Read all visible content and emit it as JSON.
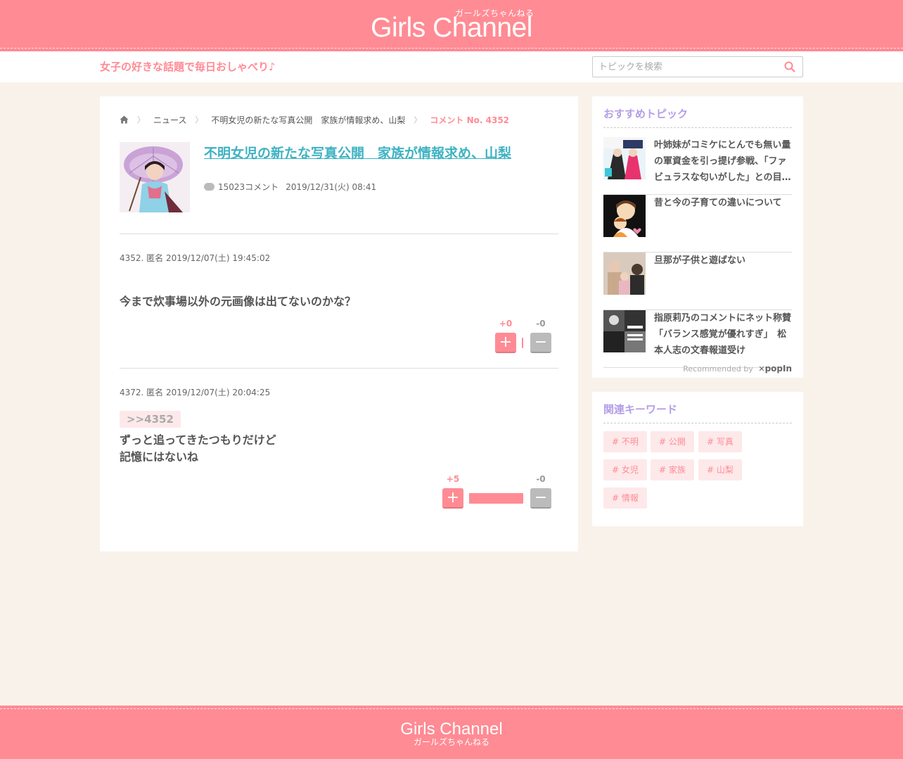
{
  "header": {
    "logo_kana": "ガールズちゃんねる",
    "logo_name": "Girls Channel",
    "tagline": "女子の好きな話題で毎日おしゃべり♪",
    "search_placeholder": "トピックを検索"
  },
  "breadcrumb": {
    "news": "ニュース",
    "topic": "不明女児の新たな写真公開　家族が情報求め、山梨",
    "current": "コメント No. 4352"
  },
  "topic": {
    "title": "不明女児の新たな写真公開　家族が情報求め、山梨",
    "comment_count": "15023コメント",
    "date": "2019/12/31(火) 08:41"
  },
  "comments": [
    {
      "header": "4352. 匿名 2019/12/07(土) 19:45:02",
      "body": "今まで炊事場以外の元画像は出てないのかな？",
      "plus": "+0",
      "minus": "-0",
      "plus_ratio": 0.0
    },
    {
      "header": "4372. 匿名 2019/12/07(土) 20:04:25",
      "anchor": ">>4352",
      "body_line1": "ずっと追ってきたつもりだけど",
      "body_line2": "記憶にはないね",
      "plus": "+5",
      "minus": "-0",
      "plus_ratio": 1.0
    }
  ],
  "vote_button": {
    "plus": "+",
    "minus": "−"
  },
  "recommended": {
    "title": "おすすめトピック",
    "items": [
      {
        "text": "叶姉妹がコミケにとんでも無い量の軍資金を引っ提げ参戦、「ファビュラスな匂いがした」との目…"
      },
      {
        "text": "昔と今の子育ての違いについて"
      },
      {
        "text": "旦那が子供と遊ばない"
      },
      {
        "text": "指原莉乃のコメントにネット称賛「バランス感覚が優れすぎ」　松本人志の文春報道受け"
      }
    ],
    "recommended_by": "Recommended by",
    "popin": "popIn"
  },
  "keywords": {
    "title": "関連キーワード",
    "items": [
      "# 不明",
      "# 公開",
      "# 写真",
      "# 女児",
      "# 家族",
      "# 山梨",
      "# 情報"
    ]
  },
  "footer": {
    "logo_name": "Girls Channel",
    "logo_kana": "ガールズちゃんねる"
  },
  "colors": {
    "brand_pink": "#ff8b94",
    "title_link": "#3eb2c2",
    "side_heading": "#b59ee8",
    "background": "#f9f2ea"
  }
}
